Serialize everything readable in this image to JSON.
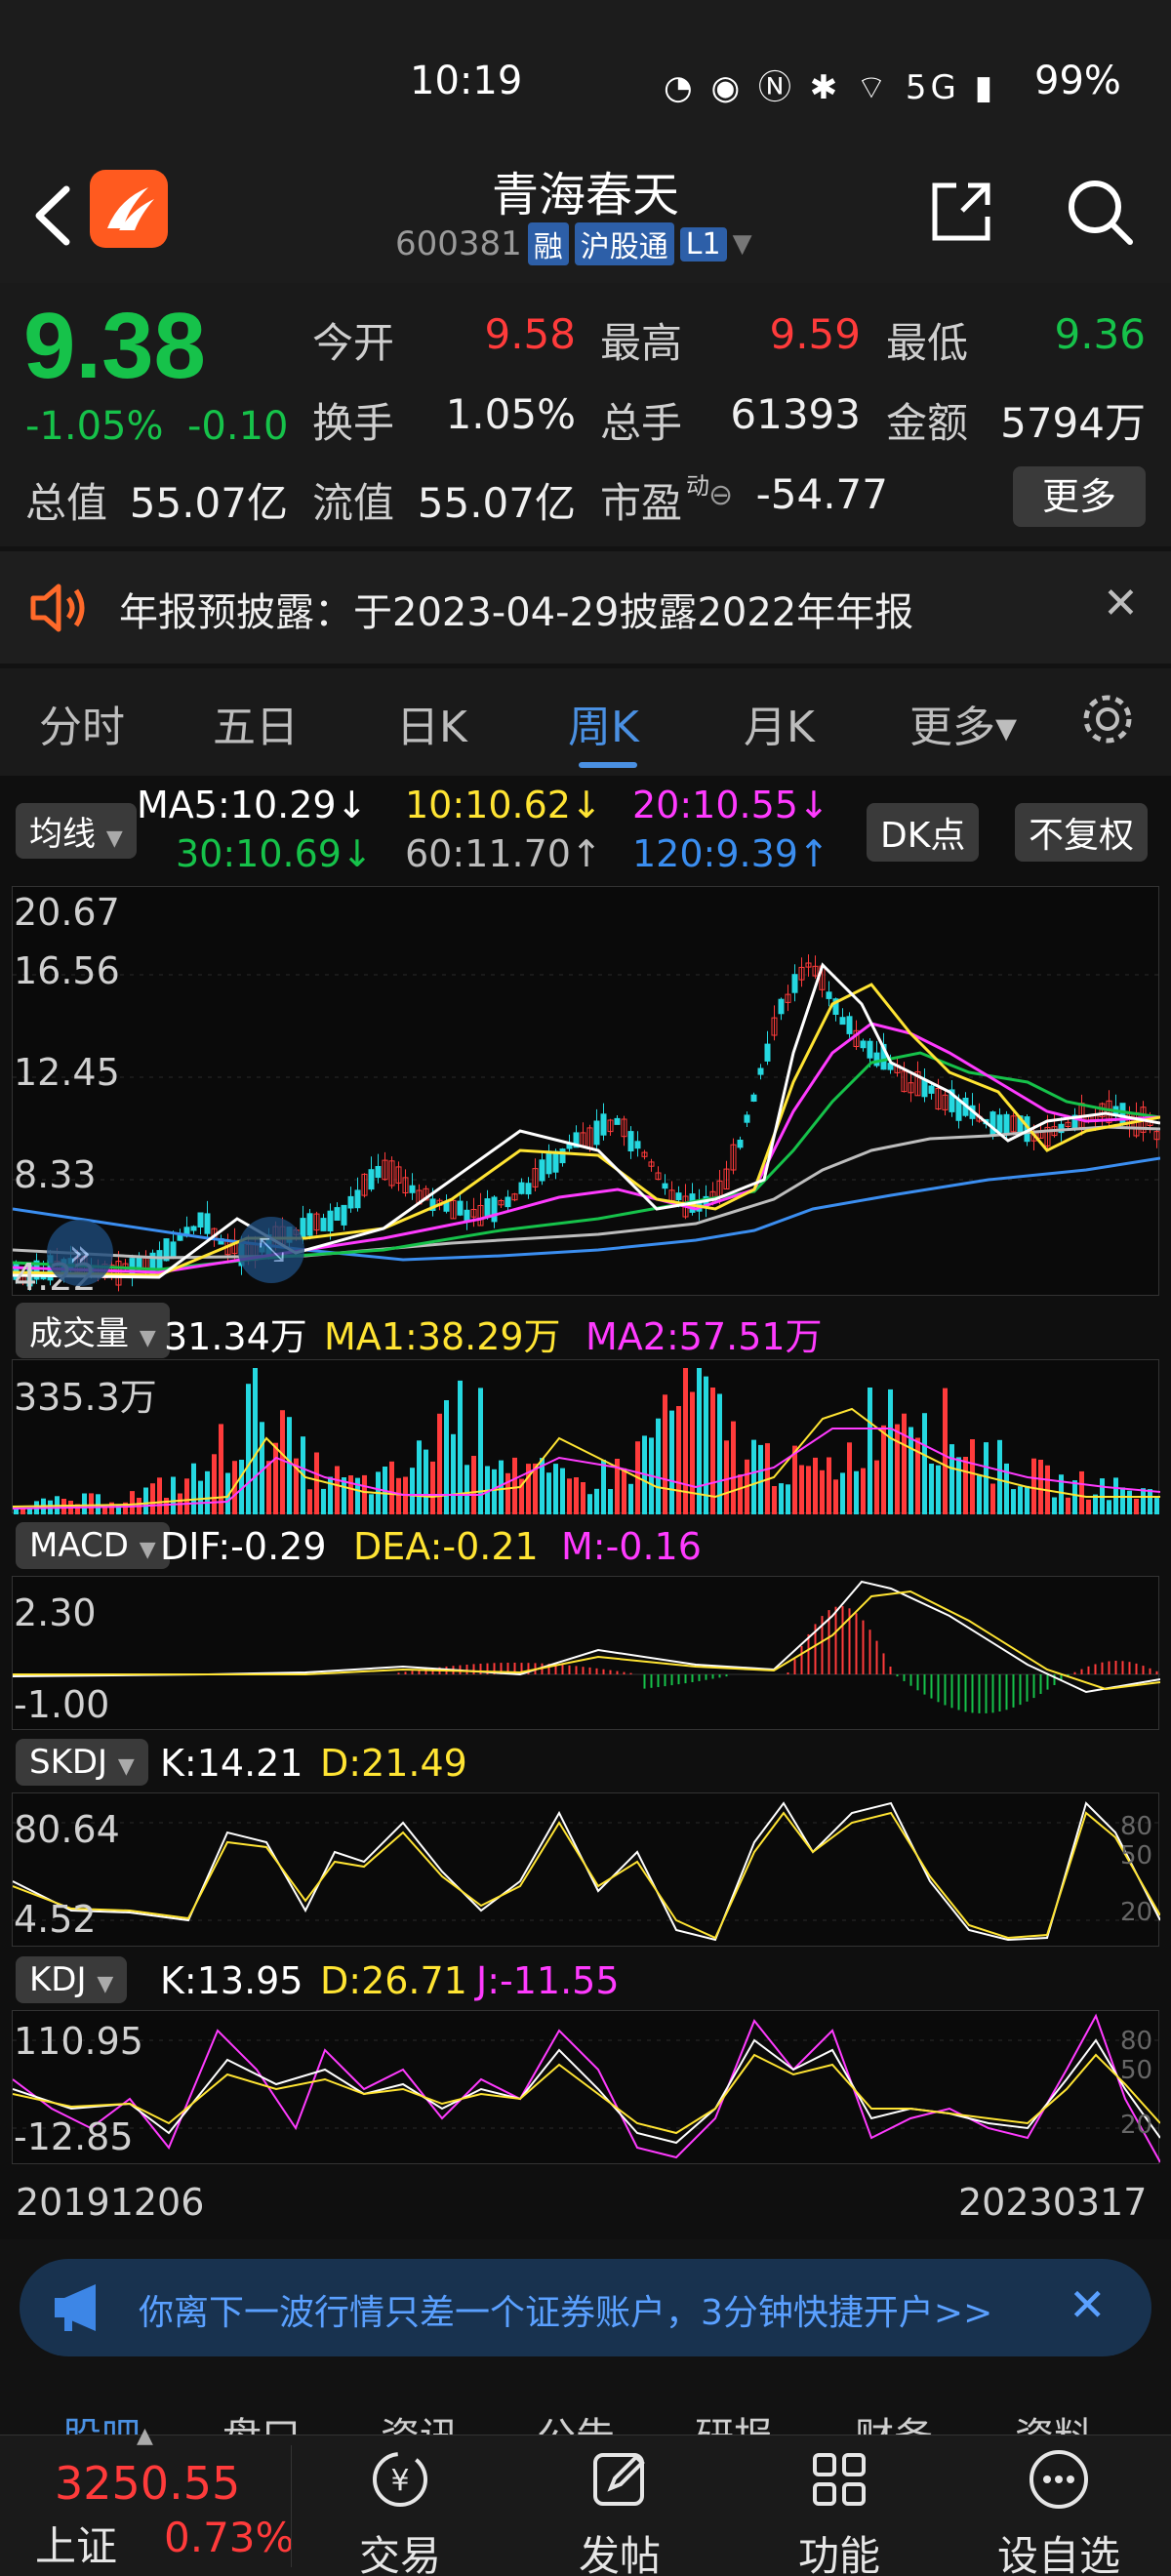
{
  "status": {
    "time": "10:19",
    "icons": "◔ ◉ Ⓝ ✱ ⌔ 5G ▮",
    "battery": "99%"
  },
  "header": {
    "title": "青海春天",
    "code": "600381",
    "tags": [
      "融",
      "沪股通",
      "L1"
    ]
  },
  "quote": {
    "price": "9.38",
    "change_pct": "-1.05%",
    "change": "-0.10",
    "rows": [
      [
        {
          "label": "今开",
          "value": "9.58",
          "color": "red"
        },
        {
          "label": "最高",
          "value": "9.59",
          "color": "red"
        },
        {
          "label": "最低",
          "value": "9.36",
          "color": "green"
        }
      ],
      [
        {
          "label": "换手",
          "value": "1.05%",
          "color": "white"
        },
        {
          "label": "总手",
          "value": "61393",
          "color": "white"
        },
        {
          "label": "金额",
          "value": "5794万",
          "color": "white"
        }
      ],
      [
        {
          "label": "总值",
          "value": "55.07亿",
          "color": "white"
        },
        {
          "label": "流值",
          "value": "55.07亿",
          "color": "white"
        },
        {
          "label": "市盈",
          "value": "-54.77",
          "color": "white"
        }
      ]
    ],
    "pe_superscript": "动",
    "more_label": "更多"
  },
  "notice": {
    "text": "年报预披露：于2023-04-29披露2022年年报"
  },
  "tabs": {
    "items": [
      "分时",
      "五日",
      "日K",
      "周K",
      "月K",
      "更多▾"
    ],
    "active": 3
  },
  "ma": {
    "button": "均线",
    "ma5": "MA5:10.29↓",
    "ma10": "10:10.62↓",
    "ma20": "20:10.55↓",
    "ma30": "30:10.69↓",
    "ma60": "60:11.70↑",
    "ma120": "120:9.39↑",
    "dk_label": "DK点",
    "adj_label": "不复权"
  },
  "price_axis": [
    "20.67",
    "16.56",
    "12.45",
    "8.33",
    "4.22"
  ],
  "volume": {
    "button": "成交量",
    "value": "31.34万",
    "ma1": "MA1:38.29万",
    "ma2": "MA2:57.51万",
    "axis_top": "335.3万"
  },
  "macd": {
    "button": "MACD",
    "dif": "DIF:-0.29",
    "dea": "DEA:-0.21",
    "m": "M:-0.16",
    "axis_top": "2.30",
    "axis_bottom": "-1.00"
  },
  "skdj": {
    "button": "SKDJ",
    "k": "K:14.21",
    "d": "D:21.49",
    "axis_top": "80.64",
    "axis_bottom": "4.52",
    "ref": [
      "80",
      "50",
      "20"
    ]
  },
  "kdj": {
    "button": "KDJ",
    "k": "K:13.95",
    "d": "D:26.71",
    "j": "J:-11.55",
    "axis_top": "110.95",
    "axis_bottom": "-12.85",
    "ref": [
      "80",
      "50",
      "20"
    ]
  },
  "dates": {
    "start": "20191206",
    "end": "20230317"
  },
  "banner": {
    "text": "你离下一波行情只差一个证券账户，3分钟快捷开户>>"
  },
  "subtabs": {
    "items": [
      "股吧",
      "盘口",
      "资讯",
      "公告",
      "研报",
      "财务",
      "资料"
    ],
    "active": 0
  },
  "footer": {
    "index_value": "3250.55",
    "index_name": "上证",
    "index_pct": "0.73%",
    "buttons": [
      "交易",
      "发帖",
      "功能",
      "设自选"
    ]
  },
  "colors": {
    "up": "#ff3b3b",
    "down": "#16c24a",
    "accent": "#4a90e2",
    "ma10": "#ffe433",
    "ma20": "#ff3bff",
    "ma30": "#16c24a",
    "ma60": "#bdbdbd",
    "ma120": "#3b8ef0"
  }
}
